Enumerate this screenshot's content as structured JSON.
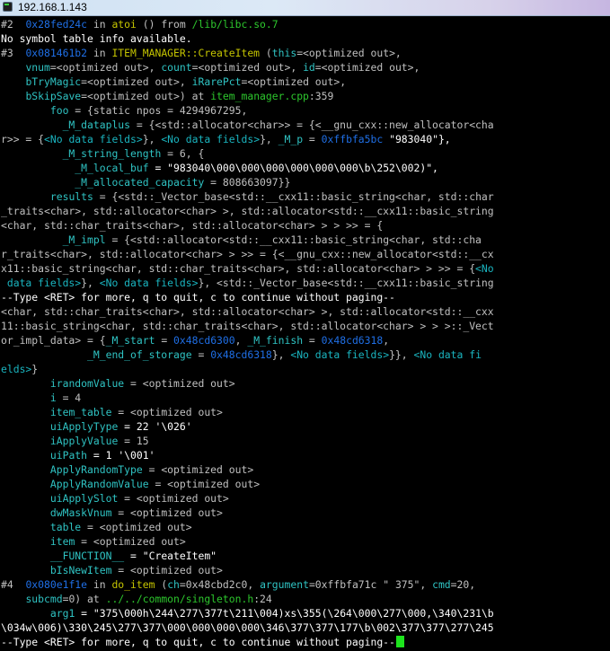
{
  "window": {
    "title": "192.168.1.143",
    "icon": "terminal-icon"
  },
  "lines": [
    [
      [
        "#2  ",
        "d"
      ],
      [
        "0x28fed24c",
        "a"
      ],
      [
        " in ",
        "d"
      ],
      [
        "atoi",
        "f"
      ],
      [
        " () from ",
        "d"
      ],
      [
        "/lib/libc.so.7",
        "g"
      ]
    ],
    [
      [
        "No symbol table info available.",
        "w"
      ]
    ],
    [
      [
        "#3  ",
        "d"
      ],
      [
        "0x081461b2",
        "a"
      ],
      [
        " in ",
        "d"
      ],
      [
        "ITEM_MANAGER::CreateItem",
        "f"
      ],
      [
        " (",
        "d"
      ],
      [
        "this",
        "v"
      ],
      [
        "=<optimized out>,",
        "d"
      ]
    ],
    [
      [
        "    ",
        "d"
      ],
      [
        "vnum",
        "v"
      ],
      [
        "=<optimized out>, ",
        "d"
      ],
      [
        "count",
        "v"
      ],
      [
        "=<optimized out>, ",
        "d"
      ],
      [
        "id",
        "v"
      ],
      [
        "=<optimized out>,",
        "d"
      ]
    ],
    [
      [
        "    ",
        "d"
      ],
      [
        "bTryMagic",
        "v"
      ],
      [
        "=<optimized out>, ",
        "d"
      ],
      [
        "iRarePct",
        "v"
      ],
      [
        "=<optimized out>,",
        "d"
      ]
    ],
    [
      [
        "    ",
        "d"
      ],
      [
        "bSkipSave",
        "v"
      ],
      [
        "=<optimized out>) at ",
        "d"
      ],
      [
        "item_manager.cpp",
        "g"
      ],
      [
        ":359",
        "d"
      ]
    ],
    [
      [
        "        ",
        "d"
      ],
      [
        "foo",
        "v"
      ],
      [
        " = {static npos = 4294967295,",
        "d"
      ]
    ],
    [
      [
        "          ",
        "d"
      ],
      [
        "_M_dataplus",
        "v"
      ],
      [
        " = {<std::allocator<char>> = {<__gnu_cxx::new_allocator<cha",
        "d"
      ]
    ],
    [
      [
        "r>> = {",
        "d"
      ],
      [
        "<No data fields>",
        "p"
      ],
      [
        "}, ",
        "d"
      ],
      [
        "<No data fields>",
        "p"
      ],
      [
        "}, ",
        "d"
      ],
      [
        "_M_p",
        "v"
      ],
      [
        " = ",
        "d"
      ],
      [
        "0xffbfa5bc",
        "a"
      ],
      [
        " \"983040\"},",
        "s"
      ]
    ],
    [
      [
        "          ",
        "d"
      ],
      [
        "_M_string_length",
        "v"
      ],
      [
        " = 6, {",
        "d"
      ]
    ],
    [
      [
        "            ",
        "d"
      ],
      [
        "_M_local_buf",
        "v"
      ],
      [
        " = \"983040\\000\\000\\000\\000\\000\\000\\b\\252\\002)\",",
        "s"
      ]
    ],
    [
      [
        "            ",
        "d"
      ],
      [
        "_M_allocated_capacity",
        "v"
      ],
      [
        " = 808663097}}",
        "d"
      ]
    ],
    [
      [
        "        ",
        "d"
      ],
      [
        "results",
        "v"
      ],
      [
        " = {<std::_Vector_base<std::__cxx11::basic_string<char, std::char",
        "d"
      ]
    ],
    [
      [
        "_traits<char>, std::allocator<char> >, std::allocator<std::__cxx11::basic_string",
        "d"
      ]
    ],
    [
      [
        "<char, std::char_traits<char>, std::allocator<char> > > >> = {",
        "d"
      ]
    ],
    [
      [
        "          ",
        "d"
      ],
      [
        "_M_impl",
        "v"
      ],
      [
        " = {<std::allocator<std::__cxx11::basic_string<char, std::cha",
        "d"
      ]
    ],
    [
      [
        "r_traits<char>, std::allocator<char> > >> = {<__gnu_cxx::new_allocator<std::__cx",
        "d"
      ]
    ],
    [
      [
        "x11::basic_string<char, std::char_traits<char>, std::allocator<char> > >> = {",
        "d"
      ],
      [
        "<No",
        "p"
      ]
    ],
    [
      [
        " data fields>",
        "p"
      ],
      [
        "}, ",
        "d"
      ],
      [
        "<No data fields>",
        "p"
      ],
      [
        "}, <std::_Vector_base<std::__cxx11::basic_string",
        "d"
      ]
    ],
    [
      [
        "--Type <RET> for more, q to quit, c to continue without paging--",
        "w"
      ]
    ],
    [
      [
        "<char, std::char_traits<char>, std::allocator<char> >, std::allocator<std::__cxx",
        "d"
      ]
    ],
    [
      [
        "11::basic_string<char, std::char_traits<char>, std::allocator<char> > > >::_Vect",
        "d"
      ]
    ],
    [
      [
        "or_impl_data> = {",
        "d"
      ],
      [
        "_M_start",
        "v"
      ],
      [
        " = ",
        "d"
      ],
      [
        "0x48cd6300",
        "a"
      ],
      [
        ", ",
        "d"
      ],
      [
        "_M_finish",
        "v"
      ],
      [
        " = ",
        "d"
      ],
      [
        "0x48cd6318",
        "a"
      ],
      [
        ",",
        "d"
      ]
    ],
    [
      [
        "              ",
        "d"
      ],
      [
        "_M_end_of_storage",
        "v"
      ],
      [
        " = ",
        "d"
      ],
      [
        "0x48cd6318",
        "a"
      ],
      [
        "}, ",
        "d"
      ],
      [
        "<No data fields>",
        "p"
      ],
      [
        "}}, ",
        "d"
      ],
      [
        "<No data fi",
        "p"
      ]
    ],
    [
      [
        "elds>",
        "p"
      ],
      [
        "}",
        "d"
      ]
    ],
    [
      [
        "        ",
        "d"
      ],
      [
        "irandomValue",
        "v"
      ],
      [
        " = <optimized out>",
        "d"
      ]
    ],
    [
      [
        "        ",
        "d"
      ],
      [
        "i",
        "v"
      ],
      [
        " = 4",
        "d"
      ]
    ],
    [
      [
        "        ",
        "d"
      ],
      [
        "item_table",
        "v"
      ],
      [
        " = <optimized out>",
        "d"
      ]
    ],
    [
      [
        "        ",
        "d"
      ],
      [
        "uiApplyType",
        "v"
      ],
      [
        " = 22 '\\026'",
        "s"
      ]
    ],
    [
      [
        "        ",
        "d"
      ],
      [
        "iApplyValue",
        "v"
      ],
      [
        " = 15",
        "d"
      ]
    ],
    [
      [
        "        ",
        "d"
      ],
      [
        "uiPath",
        "v"
      ],
      [
        " = 1 '\\001'",
        "s"
      ]
    ],
    [
      [
        "        ",
        "d"
      ],
      [
        "ApplyRandomType",
        "v"
      ],
      [
        " = <optimized out>",
        "d"
      ]
    ],
    [
      [
        "        ",
        "d"
      ],
      [
        "ApplyRandomValue",
        "v"
      ],
      [
        " = <optimized out>",
        "d"
      ]
    ],
    [
      [
        "        ",
        "d"
      ],
      [
        "uiApplySlot",
        "v"
      ],
      [
        " = <optimized out>",
        "d"
      ]
    ],
    [
      [
        "        ",
        "d"
      ],
      [
        "dwMaskVnum",
        "v"
      ],
      [
        " = <optimized out>",
        "d"
      ]
    ],
    [
      [
        "        ",
        "d"
      ],
      [
        "table",
        "v"
      ],
      [
        " = <optimized out>",
        "d"
      ]
    ],
    [
      [
        "        ",
        "d"
      ],
      [
        "item",
        "v"
      ],
      [
        " = <optimized out>",
        "d"
      ]
    ],
    [
      [
        "        ",
        "d"
      ],
      [
        "__FUNCTION__",
        "v"
      ],
      [
        " = \"CreateItem\"",
        "s"
      ]
    ],
    [
      [
        "        ",
        "d"
      ],
      [
        "bIsNewItem",
        "v"
      ],
      [
        " = <optimized out>",
        "d"
      ]
    ],
    [
      [
        "#4  ",
        "d"
      ],
      [
        "0x080e1f1e",
        "a"
      ],
      [
        " in ",
        "d"
      ],
      [
        "do_item",
        "f"
      ],
      [
        " (",
        "d"
      ],
      [
        "ch",
        "v"
      ],
      [
        "=0x48cbd2c0, ",
        "d"
      ],
      [
        "argument",
        "v"
      ],
      [
        "=0xffbfa71c \" 375\", ",
        "d"
      ],
      [
        "cmd",
        "v"
      ],
      [
        "=20,",
        "d"
      ]
    ],
    [
      [
        "    ",
        "d"
      ],
      [
        "subcmd",
        "v"
      ],
      [
        "=0) at ",
        "d"
      ],
      [
        "../../common/singleton.h",
        "g"
      ],
      [
        ":24",
        "d"
      ]
    ],
    [
      [
        "        ",
        "d"
      ],
      [
        "arg1",
        "v"
      ],
      [
        " = \"375\\000h\\244\\277\\377t\\211\\004)xs\\355(\\264\\000\\277\\000,\\340\\231\\b",
        "s"
      ]
    ],
    [
      [
        "\\034w\\006)\\330\\245\\277\\377\\000\\000\\000\\000\\346\\377\\377\\177\\b\\002\\377\\377\\277\\245",
        "s"
      ]
    ],
    [
      [
        "--Type <RET> for more, q to quit, c to continue without paging--",
        "w"
      ]
    ]
  ]
}
